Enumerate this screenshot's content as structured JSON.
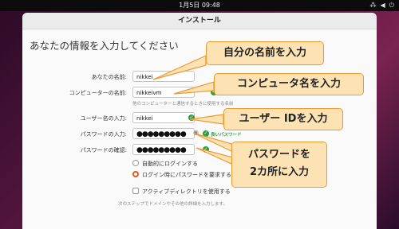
{
  "topbar": {
    "clock": "1月5日 09:48",
    "icons": [
      "network-icon",
      "volume-icon",
      "power-icon"
    ]
  },
  "window": {
    "title": "インストール"
  },
  "form": {
    "heading": "あなたの情報を入力してください",
    "name_label": "あなたの名前:",
    "name_value": "nikkei",
    "computer_label": "コンピューターの名前:",
    "computer_value": "nikkeivm",
    "computer_hint": "他のコンピューターと通信するときに使用する名前",
    "user_label": "ユーザー名の入力:",
    "user_value": "nikkei",
    "password_label": "パスワードの入力:",
    "password_value": "●●●●●●●●●",
    "password_strength": "良いパスワード",
    "confirm_label": "パスワードの確認:",
    "confirm_value": "●●●●●●●●●",
    "auto_login_label": "自動的にログインする",
    "require_password_label": "ログイン時にパスワードを要求する",
    "active_directory_label": "アクティブディレクトリを使用する",
    "ad_hint": "次のステップでドメインやその他の詳細を入力します。"
  },
  "callouts": {
    "own_name": "自分の名前を入力",
    "computer_name": "コンピュータ名を入力",
    "user_id": "ユーザー IDを入力",
    "password_line1": "パスワードを",
    "password_line2": "2カ所に入力"
  },
  "colors": {
    "accent": "#e95420",
    "check": "#2e9b3f",
    "callout_bg": "#fde3b4",
    "callout_border": "#ec9a2e"
  }
}
